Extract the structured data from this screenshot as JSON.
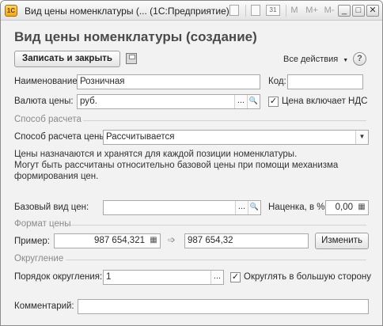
{
  "titlebar": {
    "title": "Вид цены номенклатуры (... (1С:Предприятие)",
    "app_badge": "1С",
    "tools": [
      "M",
      "M+",
      "M-"
    ],
    "calendar_label": "31",
    "minimize": "_",
    "maximize": "□",
    "close": "✕"
  },
  "heading": "Вид цены номенклатуры (создание)",
  "toolbar": {
    "save_close": "Записать и закрыть",
    "all_actions": "Все действия",
    "help": "?"
  },
  "form": {
    "name_label": "Наименование:",
    "name_value": "Розничная",
    "code_label": "Код:",
    "code_value": "",
    "currency_label": "Валюта цены:",
    "currency_value": "руб.",
    "vat_label": "Цена включает НДС",
    "vat_checked": true
  },
  "calc_method": {
    "group_title": "Способ расчета",
    "label": "Способ расчета цены:",
    "value": "Рассчитывается",
    "description_lines": [
      "Цены назначаются и хранятся для каждой позиции номенклатуры.",
      "Могут быть рассчитаны относительно базовой цены при помощи механизма",
      "формирования цен."
    ],
    "base_label": "Базовый вид цен:",
    "base_value": "",
    "markup_label": "Наценка, в %:",
    "markup_value": "0,00"
  },
  "price_format": {
    "group_title": "Формат цены",
    "example_label": "Пример:",
    "example_value": "987 654,321",
    "result_value": "987 654,32",
    "change_button": "Изменить"
  },
  "rounding": {
    "group_title": "Округление",
    "order_label": "Порядок округления:",
    "order_value": "1",
    "round_up_label": "Округлять в большую сторону",
    "round_up_checked": true
  },
  "comment": {
    "label": "Комментарий:",
    "value": ""
  },
  "icons": {
    "ellipsis": "...",
    "search": "🔍",
    "dropdown": "▼",
    "calculator": "▦",
    "arrow": "➩",
    "check": "✓"
  }
}
